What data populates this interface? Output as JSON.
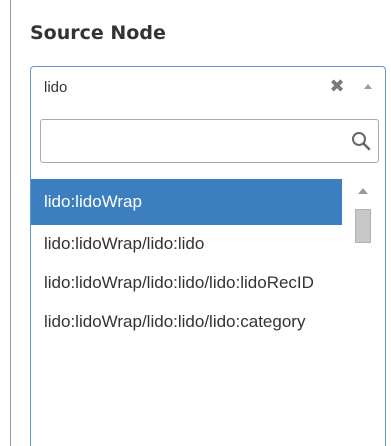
{
  "panel": {
    "title": "Source Node"
  },
  "select": {
    "value": "lido",
    "clear_icon": "close-icon",
    "toggle_icon": "chevron-up-icon"
  },
  "search": {
    "value": "",
    "placeholder": "",
    "icon": "search-icon"
  },
  "results": [
    {
      "label": "lido:lidoWrap",
      "highlighted": true
    },
    {
      "label": "lido:lidoWrap/lido:lido",
      "highlighted": false
    },
    {
      "label": "lido:lidoWrap/lido:lido/lido:lidoRecID",
      "highlighted": false
    },
    {
      "label": "lido:lidoWrap/lido:lido/lido:category",
      "highlighted": false
    }
  ],
  "colors": {
    "highlight": "#3c7fc1",
    "focus_border": "#5b9bd5"
  }
}
